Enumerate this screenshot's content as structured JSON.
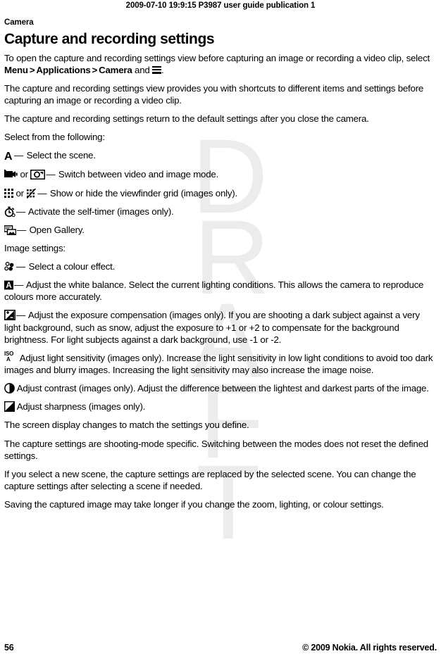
{
  "header": {
    "running_head": "2009-07-10 19:9:15 P3987 user guide publication 1"
  },
  "breadcrumb": "Camera",
  "title": "Capture and recording settings",
  "paragraphs": {
    "intro_a": "To open the capture and recording settings view before capturing an image or recording a video clip, select ",
    "menu": "Menu",
    "gt1": ">",
    "applications": "Applications",
    "gt2": ">",
    "camera": "Camera",
    "intro_b": " and ",
    "intro_c": ".",
    "p2": "The capture and recording settings view provides you with shortcuts to different items and settings before capturing an image or recording a video clip.",
    "p3": "The capture and recording settings return to the default settings after you close the camera.",
    "select_from": "Select from the following:",
    "image_settings": "Image settings:",
    "screen_display": "The screen display changes to match the settings you define.",
    "shooting_mode": "The capture settings are shooting-mode specific. Switching between the modes does not reset the defined settings.",
    "new_scene": "If you select a new scene, the capture settings are replaced by the selected scene. You can change the capture settings after selecting a scene if needed.",
    "saving": "Saving the captured image may take longer if you change the zoom, lighting, or colour settings."
  },
  "settings_list": [
    {
      "icon": "scene-icon",
      "separator": "—",
      "text": "Select the scene."
    },
    {
      "icon": "video-mode-icon",
      "or_label": "or",
      "icon2": "image-mode-icon",
      "separator": "—",
      "text": "Switch between video and image mode."
    },
    {
      "icon": "viewfinder-grid-on-icon",
      "or_label": "or",
      "icon2": "viewfinder-grid-off-icon",
      "separator": "—",
      "text": "Show or hide the viewfinder grid (images only)."
    },
    {
      "icon": "self-timer-icon",
      "separator": "—",
      "text": "Activate the self-timer (images only)."
    },
    {
      "icon": "gallery-icon",
      "separator": "—",
      "text": "Open Gallery."
    }
  ],
  "image_settings_list": [
    {
      "icon": "colour-effect-icon",
      "separator": "—",
      "text": "Select a colour effect."
    },
    {
      "icon": "white-balance-icon",
      "separator": "—",
      "text": "Adjust the white balance. Select the current lighting conditions. This allows the camera to reproduce colours more accurately."
    },
    {
      "icon": "exposure-compensation-icon",
      "separator": "—",
      "text": "Adjust the exposure compensation (images only). If you are shooting a dark subject against a very light background, such as snow, adjust the exposure to +1 or +2 to compensate for the background brightness. For light subjects against a dark background, use -1 or -2."
    },
    {
      "icon": "light-sensitivity-icon",
      "separator": "",
      "text": "Adjust light sensitivity (images only). Increase the light sensitivity in low light conditions to avoid too dark images and blurry images. Increasing the light sensitivity may also increase the image noise."
    },
    {
      "icon": "contrast-icon",
      "separator": "",
      "text": "Adjust contrast (images only). Adjust the difference between the lightest and darkest parts of the image."
    },
    {
      "icon": "sharpness-icon",
      "separator": "",
      "text": "Adjust sharpness (images only)."
    }
  ],
  "icon_labels": {
    "scene": "A",
    "white_balance": "A",
    "iso_top": "ISO",
    "iso_bottom": "A",
    "timer_zero": "0"
  },
  "watermark": {
    "letters": [
      "D",
      "R",
      "A",
      "F",
      "T"
    ],
    "color": "#ececec"
  },
  "footer": {
    "page_number": "56",
    "copyright": "© 2009 Nokia. All rights reserved."
  }
}
